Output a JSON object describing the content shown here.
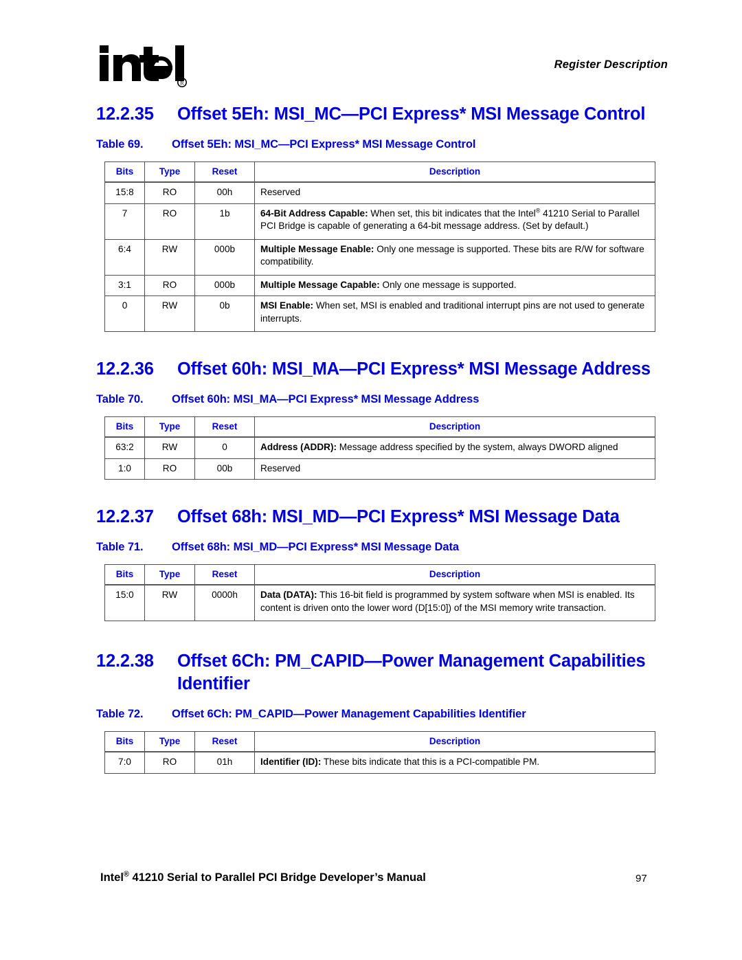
{
  "header": {
    "logo_alt": "intel",
    "running_title": "Register Description"
  },
  "table_columns": {
    "bits": "Bits",
    "type": "Type",
    "reset": "Reset",
    "description": "Description"
  },
  "sections": [
    {
      "number": "12.2.35",
      "title": "Offset 5Eh: MSI_MC—PCI Express* MSI Message Control",
      "table": {
        "label": "Table 69.",
        "caption": "Offset 5Eh: MSI_MC—PCI Express* MSI Message Control",
        "rows": [
          {
            "bits": "15:8",
            "type": "RO",
            "reset": "00h",
            "desc_bold": "",
            "desc_text": "Reserved"
          },
          {
            "bits": "7",
            "type": "RO",
            "reset": "1b",
            "desc_bold": "64-Bit Address Capable:",
            "desc_text": " When set, this bit indicates that the Intel® 41210 Serial to Parallel PCI Bridge is capable of generating a 64-bit message address. (Set by default.)"
          },
          {
            "bits": "6:4",
            "type": "RW",
            "reset": "000b",
            "desc_bold": "Multiple Message Enable:",
            "desc_text": " Only one message is supported. These bits are R/W for software compatibility."
          },
          {
            "bits": "3:1",
            "type": "RO",
            "reset": "000b",
            "desc_bold": "Multiple Message Capable:",
            "desc_text": " Only one message is supported."
          },
          {
            "bits": "0",
            "type": "RW",
            "reset": "0b",
            "desc_bold": "MSI Enable:",
            "desc_text": " When set, MSI is enabled and traditional interrupt pins are not used to generate interrupts."
          }
        ]
      }
    },
    {
      "number": "12.2.36",
      "title": "Offset 60h: MSI_MA—PCI Express* MSI Message Address",
      "table": {
        "label": "Table 70.",
        "caption": "Offset 60h: MSI_MA—PCI Express* MSI Message Address",
        "rows": [
          {
            "bits": "63:2",
            "type": "RW",
            "reset": "0",
            "desc_bold": "Address (ADDR):",
            "desc_text": " Message address specified by the system, always DWORD aligned"
          },
          {
            "bits": "1:0",
            "type": "RO",
            "reset": "00b",
            "desc_bold": "",
            "desc_text": "Reserved"
          }
        ]
      }
    },
    {
      "number": "12.2.37",
      "title": "Offset 68h: MSI_MD—PCI Express* MSI Message Data",
      "table": {
        "label": "Table 71.",
        "caption": "Offset 68h: MSI_MD—PCI Express* MSI Message Data",
        "rows": [
          {
            "bits": "15:0",
            "type": "RW",
            "reset": "0000h",
            "desc_bold": "Data (DATA):",
            "desc_text": " This 16-bit field is programmed by system software when MSI is enabled. Its content is driven onto the lower word (D[15:0]) of the MSI memory write transaction."
          }
        ]
      }
    },
    {
      "number": "12.2.38",
      "title": "Offset 6Ch: PM_CAPID—Power Management Capabilities Identifier",
      "table": {
        "label": "Table 72.",
        "caption": "Offset 6Ch: PM_CAPID—Power Management Capabilities Identifier",
        "rows": [
          {
            "bits": "7:0",
            "type": "RO",
            "reset": "01h",
            "desc_bold": "Identifier (ID):",
            "desc_text": " These bits indicate that this is a PCI-compatible PM."
          }
        ]
      }
    }
  ],
  "footer": {
    "manual_title_pre": "Intel",
    "manual_title_post": " 41210 Serial to Parallel PCI Bridge Developer’s Manual",
    "page_number": "97"
  },
  "colors": {
    "heading_blue": "#0000D8",
    "text_black": "#000000",
    "rule_gray": "#4D4D4D"
  }
}
